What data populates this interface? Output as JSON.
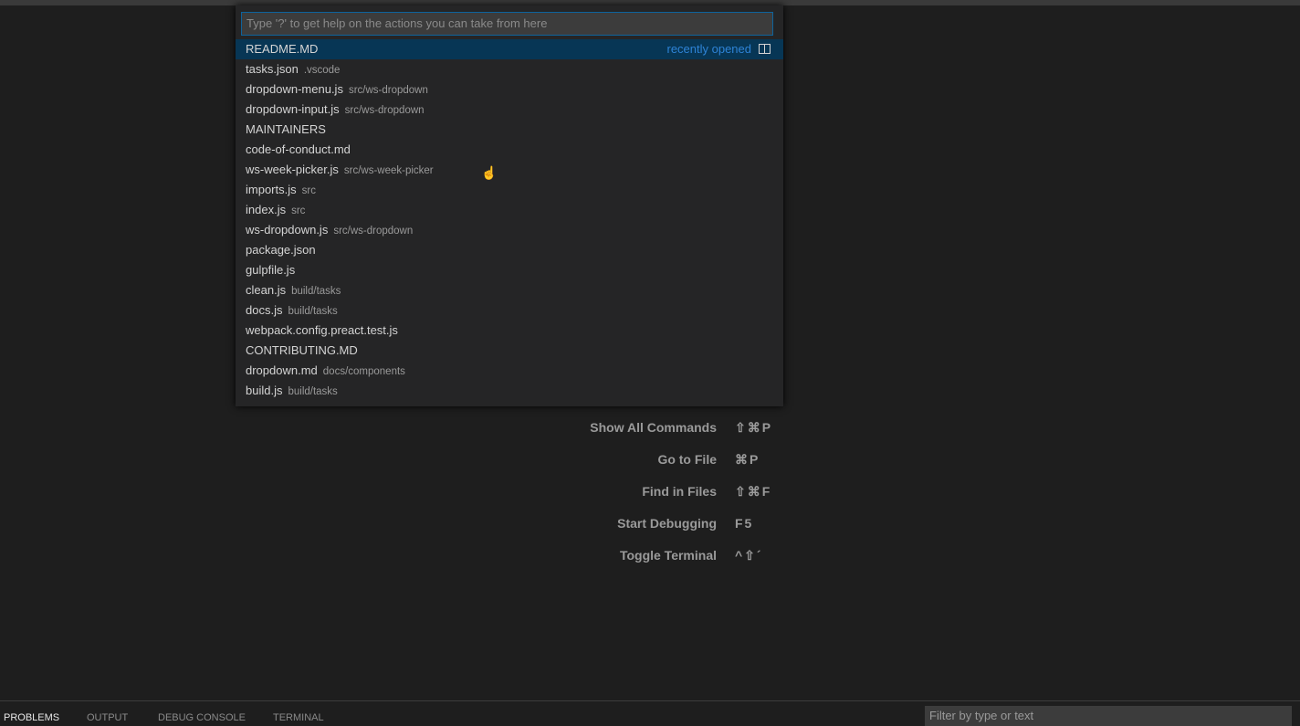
{
  "quick_open": {
    "placeholder": "Type '?' to get help on the actions you can take from here",
    "items": [
      {
        "name": "README.MD",
        "path": "",
        "meta": "recently opened",
        "selected": true
      },
      {
        "name": "tasks.json",
        "path": ".vscode"
      },
      {
        "name": "dropdown-menu.js",
        "path": "src/ws-dropdown"
      },
      {
        "name": "dropdown-input.js",
        "path": "src/ws-dropdown"
      },
      {
        "name": "MAINTAINERS",
        "path": ""
      },
      {
        "name": "code-of-conduct.md",
        "path": ""
      },
      {
        "name": "ws-week-picker.js",
        "path": "src/ws-week-picker"
      },
      {
        "name": "imports.js",
        "path": "src"
      },
      {
        "name": "index.js",
        "path": "src"
      },
      {
        "name": "ws-dropdown.js",
        "path": "src/ws-dropdown"
      },
      {
        "name": "package.json",
        "path": ""
      },
      {
        "name": "gulpfile.js",
        "path": ""
      },
      {
        "name": "clean.js",
        "path": "build/tasks"
      },
      {
        "name": "docs.js",
        "path": "build/tasks"
      },
      {
        "name": "webpack.config.preact.test.js",
        "path": ""
      },
      {
        "name": "CONTRIBUTING.MD",
        "path": ""
      },
      {
        "name": "dropdown.md",
        "path": "docs/components"
      },
      {
        "name": "build.js",
        "path": "build/tasks"
      }
    ]
  },
  "shortcuts": [
    {
      "label": "Show All Commands",
      "key": "⇧⌘P"
    },
    {
      "label": "Go to File",
      "key": "⌘P"
    },
    {
      "label": "Find in Files",
      "key": "⇧⌘F"
    },
    {
      "label": "Start Debugging",
      "key": "F5"
    },
    {
      "label": "Toggle Terminal",
      "key": "^⇧´"
    }
  ],
  "panel": {
    "tabs": [
      "PROBLEMS",
      "OUTPUT",
      "DEBUG CONSOLE",
      "TERMINAL"
    ],
    "active_tab": "PROBLEMS",
    "filter_placeholder": "Filter by type or text"
  },
  "colors": {
    "selection": "#073655",
    "accent": "#2e83d6",
    "background": "#1e1e1e"
  }
}
